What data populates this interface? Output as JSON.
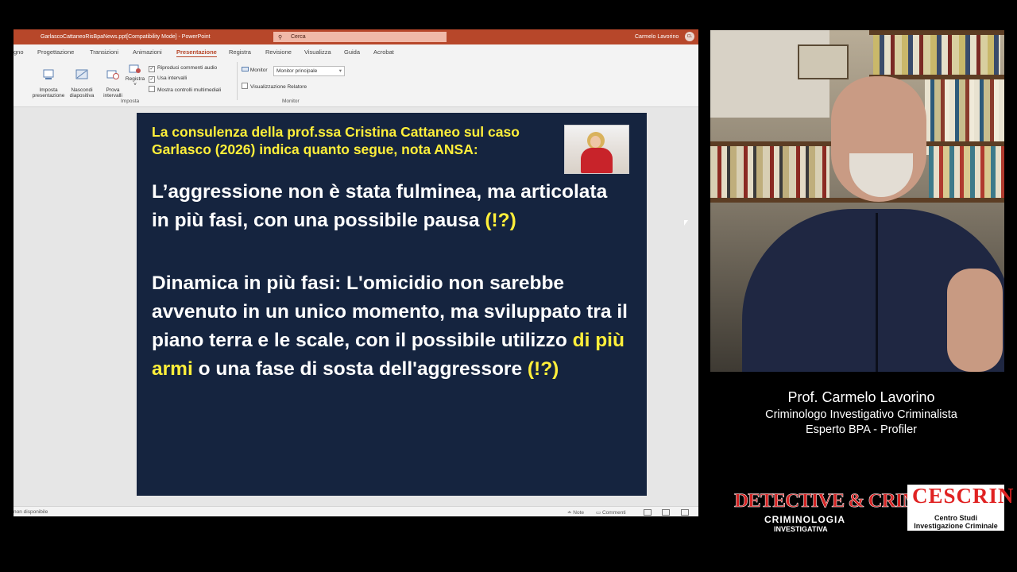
{
  "window": {
    "document_title": "GarlascoCattaneoRisBpaNews.ppt[Compatibility Mode] - PowerPoint",
    "search_placeholder": "Cerca",
    "user_name": "Carmelo Lavorino",
    "user_initials": "CL"
  },
  "tabs": [
    "gno",
    "Progettazione",
    "Transizioni",
    "Animazioni",
    "Presentazione",
    "Registra",
    "Revisione",
    "Visualizza",
    "Guida",
    "Acrobat"
  ],
  "active_tab": "Presentazione",
  "ribbon": {
    "imposta_presentazione": "Imposta\npresentazione",
    "nascondi_diapositiva": "Nascondi\ndiapositiva",
    "prova_intervalli": "Prova\nintervalli",
    "registra": "Registra",
    "riproduci_commenti": "Riproduci commenti audio",
    "usa_intervalli": "Usa intervalli",
    "mostra_controlli": "Mostra controlli multimediali",
    "group_imposta": "Imposta",
    "monitor_label": "Monitor",
    "monitor_value": "Monitor principale",
    "visualizzazione_relatore": "Visualizzazione Relatore",
    "group_monitor": "Monitor"
  },
  "slide": {
    "header": "La consulenza della prof.ssa Cristina Cattaneo sul caso Garlasco (2026) indica quanto segue, nota ANSA:",
    "p1_text": "L’aggressione non  è stata fulminea, ma articolata in più fasi, con una possibile pausa ",
    "p1_mark": "(!?)",
    "p2_a": "Dinamica in più fasi: L'omicidio non sarebbe avvenuto in un unico momento, ma sviluppato tra il piano terra e le scale, con il possibile utilizzo ",
    "p2_hl": "di più armi",
    "p2_b": " o una fase di sosta dell'aggressore ",
    "p2_mark": "(!?)"
  },
  "statusbar": {
    "left": "non disponibile",
    "note": "Note",
    "comments": "Commenti"
  },
  "captions": {
    "name": "Prof. Carmelo Lavorino",
    "role1": "Criminologo Investigativo Criminalista",
    "role2": "Esperto BPA - Profiler"
  },
  "logos": {
    "detective_title": "DETECTIVE & CRIME",
    "detective_sub1": "CRIMINOLOGIA",
    "detective_sub2": "INVESTIGATIVA",
    "cescrin_title": "CESCRIN",
    "cescrin_sub1": "Centro Studi",
    "cescrin_sub2": "Investigazione Criminale"
  },
  "colors": {
    "ppt_accent": "#b7472a",
    "slide_bg": "#15243f",
    "slide_highlight": "#ffef3a"
  }
}
